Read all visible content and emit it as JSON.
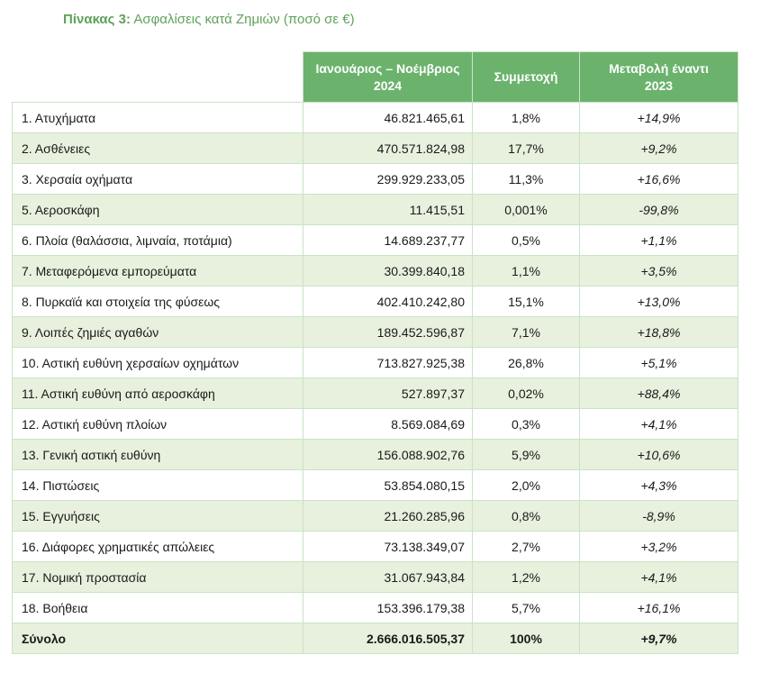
{
  "caption": {
    "label": "Πίνακας 3:",
    "text": "Ασφαλίσεις κατά Ζημιών (ποσό σε €)"
  },
  "columns": {
    "period_line1": "Ιανουάριος – Νοέμβριος",
    "period_line2": "2024",
    "share": "Συμμετοχή",
    "change_line1": "Μεταβολή έναντι",
    "change_line2": "2023"
  },
  "rows": [
    {
      "category": "1.   Ατυχήματα",
      "amount": "46.821.465,61",
      "share": "1,8%",
      "change": "+14,9%"
    },
    {
      "category": "2.   Ασθένειες",
      "amount": "470.571.824,98",
      "share": "17,7%",
      "change": "+9,2%"
    },
    {
      "category": "3.   Χερσαία οχήματα",
      "amount": "299.929.233,05",
      "share": "11,3%",
      "change": "+16,6%"
    },
    {
      "category": "5.   Αεροσκάφη",
      "amount": "11.415,51",
      "share": "0,001%",
      "change": "-99,8%"
    },
    {
      "category": "6.   Πλοία (θαλάσσια, λιμναία, ποτάμια)",
      "amount": "14.689.237,77",
      "share": "0,5%",
      "change": "+1,1%"
    },
    {
      "category": "7.   Μεταφερόμενα εμπορεύματα",
      "amount": "30.399.840,18",
      "share": "1,1%",
      "change": "+3,5%"
    },
    {
      "category": "8.   Πυρκαϊά και στοιχεία της φύσεως",
      "amount": "402.410.242,80",
      "share": "15,1%",
      "change": "+13,0%"
    },
    {
      "category": "9.   Λοιπές ζημιές αγαθών",
      "amount": "189.452.596,87",
      "share": "7,1%",
      "change": "+18,8%"
    },
    {
      "category": "10. Αστική ευθύνη χερσαίων οχημάτων",
      "amount": "713.827.925,38",
      "share": "26,8%",
      "change": "+5,1%"
    },
    {
      "category": "11. Αστική ευθύνη από αεροσκάφη",
      "amount": "527.897,37",
      "share": "0,02%",
      "change": "+88,4%"
    },
    {
      "category": "12. Αστική ευθύνη πλοίων",
      "amount": "8.569.084,69",
      "share": "0,3%",
      "change": "+4,1%"
    },
    {
      "category": "13. Γενική αστική ευθύνη",
      "amount": "156.088.902,76",
      "share": "5,9%",
      "change": "+10,6%"
    },
    {
      "category": "14. Πιστώσεις",
      "amount": "53.854.080,15",
      "share": "2,0%",
      "change": "+4,3%"
    },
    {
      "category": "15. Εγγυήσεις",
      "amount": "21.260.285,96",
      "share": "0,8%",
      "change": "-8,9%"
    },
    {
      "category": "16. Διάφορες χρηματικές απώλειες",
      "amount": "73.138.349,07",
      "share": "2,7%",
      "change": "+3,2%"
    },
    {
      "category": "17. Νομική προστασία",
      "amount": "31.067.943,84",
      "share": "1,2%",
      "change": "+4,1%"
    },
    {
      "category": "18. Βοήθεια",
      "amount": "153.396.179,38",
      "share": "5,7%",
      "change": "+16,1%"
    }
  ],
  "total": {
    "category": "Σύνολο",
    "amount": "2.666.016.505,37",
    "share": "100%",
    "change": "+9,7%"
  },
  "colors": {
    "header_green": "#6bb36d",
    "caption_green": "#5fa25a",
    "band_green": "#e7f1dd",
    "border": "#c9e3c5"
  }
}
